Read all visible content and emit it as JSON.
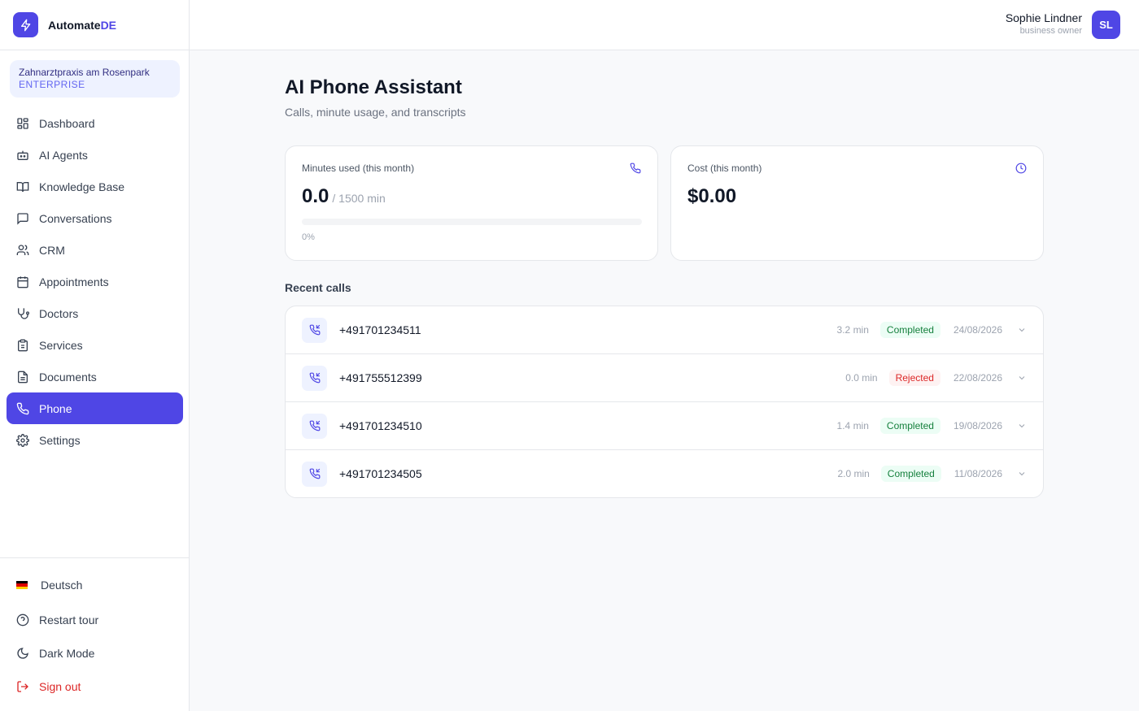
{
  "brand": {
    "name_main": "Automate",
    "name_accent": "DE",
    "accent_color": "#4f46e5"
  },
  "organization": {
    "name": "Zahnarztpraxis am Rosenpark",
    "plan": "ENTERPRISE"
  },
  "nav": [
    {
      "label": "Dashboard",
      "icon": "dashboard-icon"
    },
    {
      "label": "AI Agents",
      "icon": "bot-icon"
    },
    {
      "label": "Knowledge Base",
      "icon": "book-icon"
    },
    {
      "label": "Conversations",
      "icon": "chat-icon"
    },
    {
      "label": "CRM",
      "icon": "users-icon"
    },
    {
      "label": "Appointments",
      "icon": "calendar-icon"
    },
    {
      "label": "Doctors",
      "icon": "stethoscope-icon"
    },
    {
      "label": "Services",
      "icon": "clipboard-icon"
    },
    {
      "label": "Documents",
      "icon": "document-icon"
    },
    {
      "label": "Phone",
      "icon": "phone-icon",
      "active": true
    },
    {
      "label": "Settings",
      "icon": "gear-icon"
    }
  ],
  "footer": {
    "language": "Deutsch",
    "restart_tour": "Restart tour",
    "dark_mode": "Dark Mode",
    "sign_out": "Sign out"
  },
  "user": {
    "name": "Sophie Lindner",
    "role": "business owner",
    "initials": "SL"
  },
  "page": {
    "title": "AI Phone Assistant",
    "subtitle": "Calls, minute usage, and transcripts"
  },
  "minutes_card": {
    "label": "Minutes used (this month)",
    "value": "0.0",
    "limit": "/ 1500 min",
    "percent_text": "0%",
    "percent": 0
  },
  "cost_card": {
    "label": "Cost (this month)",
    "value": "$0.00"
  },
  "recent_calls": {
    "title": "Recent calls",
    "items": [
      {
        "number": "+491701234511",
        "minutes": "3.2 min",
        "status": "Completed",
        "status_key": "completed",
        "date": "24/08/2026"
      },
      {
        "number": "+491755512399",
        "minutes": "0.0 min",
        "status": "Rejected",
        "status_key": "rejected",
        "date": "22/08/2026"
      },
      {
        "number": "+491701234510",
        "minutes": "1.4 min",
        "status": "Completed",
        "status_key": "completed",
        "date": "19/08/2026"
      },
      {
        "number": "+491701234505",
        "minutes": "2.0 min",
        "status": "Completed",
        "status_key": "completed",
        "date": "11/08/2026"
      }
    ]
  },
  "colors": {
    "primary": "#4f46e5",
    "success": "#15803d",
    "danger": "#dc2626"
  }
}
